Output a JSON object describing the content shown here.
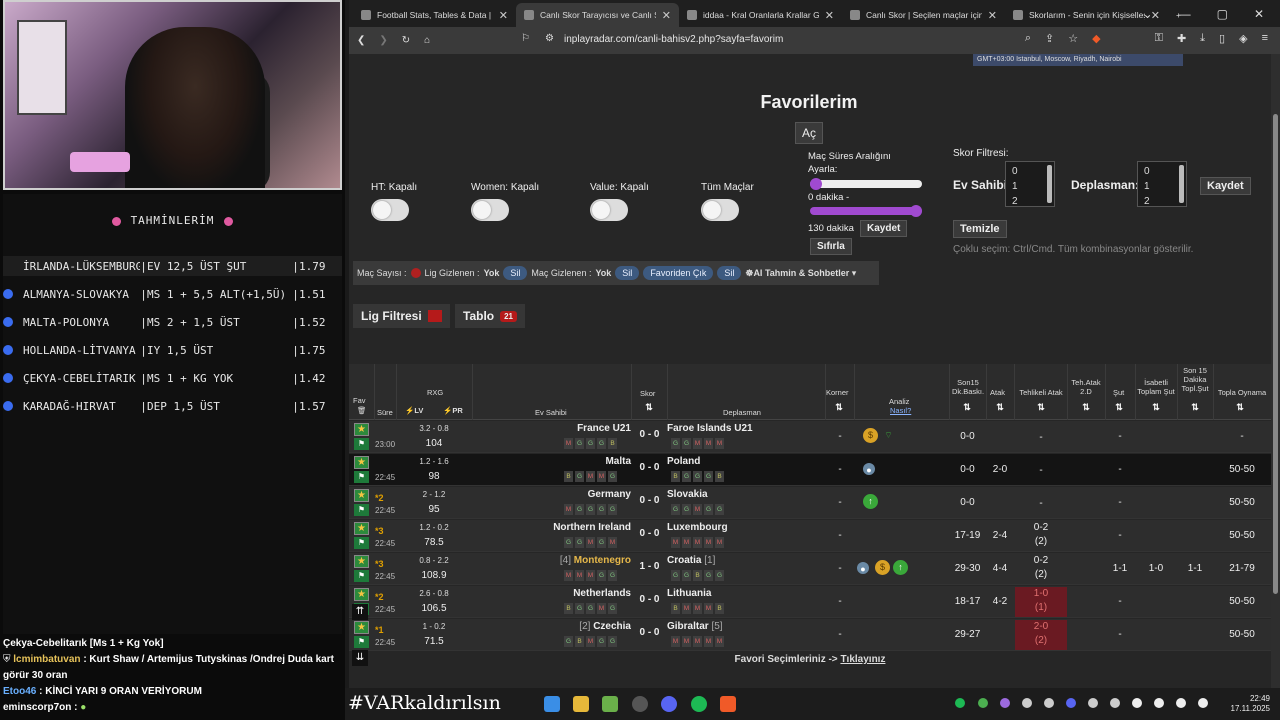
{
  "stream": {
    "predictions_title": "TAHMİNLERİM",
    "predictions": [
      {
        "match": "İRLANDA-LÜKSEMBURG",
        "tip": "EV 12,5 ÜST ŞUT",
        "odds": "1.79",
        "dot": false
      },
      {
        "match": "ALMANYA-SLOVAKYA",
        "tip": "MS 1 + 5,5 ALT(+1,5Ü)",
        "odds": "1.51",
        "dot": true
      },
      {
        "match": "MALTA-POLONYA",
        "tip": "MS 2 + 1,5 ÜST",
        "odds": "1.52",
        "dot": true
      },
      {
        "match": "HOLLANDA-LİTVANYA",
        "tip": "IY 1,5 ÜST",
        "odds": "1.75",
        "dot": true
      },
      {
        "match": "ÇEKYA-CEBELİTARIK",
        "tip": "MS 1 + KG YOK",
        "odds": "1.42",
        "dot": true
      },
      {
        "match": "KARADAĞ-HIRVAT",
        "tip": "DEP 1,5 ÜST",
        "odds": "1.57",
        "dot": true
      }
    ],
    "chat": [
      {
        "user": "",
        "text": "Çekya-Cebelitarık [Ms 1 + Kg Yok]"
      },
      {
        "user": "lcmimbatuvan",
        "text": ": Kurt Shaw / Artemijus Tutyskinas /Ondrej Duda kart görür 30 oran"
      },
      {
        "user": "Etoo46",
        "text": ": KİNCİ YARI 9 ORAN VERİYORUM"
      },
      {
        "user": "eminscorp7on",
        "text": ":"
      }
    ]
  },
  "browser": {
    "tabs": [
      {
        "label": "Football Stats, Tables & Data | Socc",
        "active": false
      },
      {
        "label": "Canlı Skor Tarayıcısı ve Canlı S",
        "active": true
      },
      {
        "label": "iddaa - Kral Oranlarla Krallar Gibi K",
        "active": false
      },
      {
        "label": "Canlı Skor | Seçilen maçlar için canl",
        "active": false
      },
      {
        "label": "Skorlarım - Senin için Kişiselleştirilm",
        "active": false
      }
    ],
    "url": "inplayradar.com/canli-bahisv2.php?sayfa=favorim",
    "timezone": "GMT+03:00 Istanbul, Moscow, Riyadh, Nairobi"
  },
  "page": {
    "title": "Favorilerim",
    "ac_button": "Aç",
    "toggles": [
      {
        "label": "HT: Kapalı"
      },
      {
        "label": "Women: Kapalı"
      },
      {
        "label": "Value: Kapalı"
      },
      {
        "label": "Tüm Maçlar"
      }
    ],
    "range": {
      "label1": "Maç Süres Aralığını",
      "label2": "Ayarla:",
      "min_label": "0 dakika -",
      "max_label": "130 dakika",
      "save": "Kaydet",
      "reset": "Sıfırla"
    },
    "score_filter": {
      "label": "Skor Filtresi:",
      "home": "Ev Sahibi:",
      "away": "Deplasman:",
      "home_options": [
        "0",
        "1",
        "2"
      ],
      "away_options": [
        "0",
        "1",
        "2"
      ],
      "save": "Kaydet",
      "clear": "Temizle",
      "note": "Çoklu seçim: Ctrl/Cmd. Tüm kombinasyonlar gösterilir."
    },
    "filterbar": {
      "count_label": "Maç Sayısı :",
      "lig_hidden": "Lig Gizlenen :",
      "lig_hidden_val": "Yok",
      "sil1": "Sil",
      "mac_hidden": "Maç Gizlenen :",
      "mac_hidden_val": "Yok",
      "sil2": "Sil",
      "fav_remove": "Favoriden Çık",
      "sil3": "Sil",
      "ai": "AI Tahmin & Sohbetler"
    },
    "lig_filter": "Lig Filtresi",
    "tablo": "Tablo",
    "tablo_count": "21",
    "headers": {
      "fav": "Fav",
      "sure": "Süre",
      "rxg": "RXG",
      "lv": "LV",
      "pr": "PR",
      "ev": "Ev Sahibi",
      "skor": "Skor",
      "dep": "Deplasman",
      "korner": "Korner",
      "analiz": "Analiz",
      "nasil": "Nasıl?",
      "son15": "Son15 Dk.Baskı.",
      "atak": "Atak",
      "teh": "Tehlikeli Atak",
      "teh2d": "Teh.Atak 2.D",
      "sut": "Şut",
      "isabetli": "İsabetli Toplam Şut",
      "son15s": "Son 15 Dakika Topl.Şut",
      "topla": "Topla Oynama"
    },
    "rows": [
      {
        "star": "",
        "time": "23:00",
        "rxg": "3.2 - 0.8",
        "rxg2": "104",
        "home": "France U21",
        "homeRank": "",
        "score": "0 - 0",
        "away": "Faroe Islands U21",
        "awayRank": "",
        "hf": [
          "M",
          "G",
          "G",
          "G",
          "B"
        ],
        "af": [
          "G",
          "G",
          "M",
          "M",
          "M"
        ],
        "korner": "-",
        "icons": [
          "bag",
          "wifi"
        ],
        "son15": "0-0",
        "atak": "",
        "teh": "-",
        "teh2": "",
        "sut": "-",
        "isa": "",
        "s15": "",
        "topla": "-",
        "dark": false
      },
      {
        "star": "",
        "time": "22:45",
        "rxg": "1.2 - 1.6",
        "rxg2": "98",
        "home": "Malta",
        "homeRank": "",
        "score": "0 - 0",
        "away": "Poland",
        "awayRank": "",
        "hf": [
          "B",
          "G",
          "M",
          "M",
          "G"
        ],
        "af": [
          "B",
          "G",
          "G",
          "G",
          "B"
        ],
        "korner": "-",
        "icons": [
          "bomb"
        ],
        "son15": "0-0",
        "atak": "2-0",
        "teh": "-",
        "teh2": "",
        "sut": "-",
        "isa": "",
        "s15": "",
        "topla": "50-50",
        "dark": true
      },
      {
        "star": "2",
        "time": "22:45",
        "rxg": "2 - 1.2",
        "rxg2": "95",
        "home": "Germany",
        "homeRank": "",
        "score": "0 - 0",
        "away": "Slovakia",
        "awayRank": "",
        "hf": [
          "M",
          "G",
          "G",
          "G",
          "G"
        ],
        "af": [
          "G",
          "G",
          "M",
          "G",
          "G"
        ],
        "korner": "-",
        "icons": [
          "up"
        ],
        "son15": "0-0",
        "atak": "",
        "teh": "-",
        "teh2": "",
        "sut": "-",
        "isa": "",
        "s15": "",
        "topla": "50-50",
        "dark": false
      },
      {
        "star": "3",
        "time": "22:45",
        "rxg": "1.2 - 0.2",
        "rxg2": "78.5",
        "home": "Northern Ireland",
        "homeRank": "",
        "score": "0 - 0",
        "away": "Luxembourg",
        "awayRank": "",
        "hf": [
          "G",
          "G",
          "M",
          "G",
          "M"
        ],
        "af": [
          "M",
          "M",
          "M",
          "M",
          "M"
        ],
        "korner": "-",
        "icons": [],
        "son15": "17-19",
        "atak": "2-4",
        "teh": "0-2",
        "teh2": "(2)",
        "sut": "-",
        "isa": "",
        "s15": "",
        "topla": "50-50",
        "dark": false
      },
      {
        "star": "3",
        "time": "22:45",
        "rxg": "0.8 - 2.2",
        "rxg2": "108.9",
        "home": "Montenegro",
        "homeRank": "[4]",
        "score": "1 - 0",
        "away": "Croatia",
        "awayRank": "[1]",
        "hf": [
          "M",
          "M",
          "M",
          "G",
          "G"
        ],
        "af": [
          "G",
          "G",
          "B",
          "G",
          "G"
        ],
        "korner": "-",
        "icons": [
          "bomb",
          "bag",
          "up"
        ],
        "son15": "29-30",
        "atak": "4-4",
        "teh": "0-2",
        "teh2": "(2)",
        "sut": "1-1",
        "isa": "1-0",
        "s15": "1-1",
        "topla": "21-79",
        "dark": false
      },
      {
        "star": "2",
        "time": "22:45",
        "rxg": "2.6 - 0.8",
        "rxg2": "106.5",
        "home": "Netherlands",
        "homeRank": "",
        "score": "0 - 0",
        "away": "Lithuania",
        "awayRank": "",
        "hf": [
          "B",
          "G",
          "G",
          "M",
          "G"
        ],
        "af": [
          "B",
          "M",
          "M",
          "M",
          "B"
        ],
        "korner": "-",
        "icons": [],
        "son15": "18-17",
        "atak": "4-2",
        "teh": "1-0",
        "teh2": "(1)",
        "sut": "-",
        "isa": "",
        "s15": "",
        "topla": "50-50",
        "dark": false,
        "red": true
      },
      {
        "star": "1",
        "time": "22:45",
        "rxg": "1 - 0.2",
        "rxg2": "71.5",
        "home": "Czechia",
        "homeRank": "[2]",
        "score": "0 - 0",
        "away": "Gibraltar",
        "awayRank": "[5]",
        "hf": [
          "G",
          "B",
          "M",
          "G",
          "G"
        ],
        "af": [
          "M",
          "M",
          "M",
          "M",
          "M"
        ],
        "korner": "-",
        "icons": [],
        "son15": "29-27",
        "atak": "",
        "teh": "2-0",
        "teh2": "(2)",
        "sut": "-",
        "isa": "",
        "s15": "",
        "topla": "50-50",
        "dark": false,
        "red": true
      }
    ],
    "footer": "Favori Seçimleriniz ->",
    "footer_link": "Tıklayınız"
  },
  "taskbar": {
    "hashtag": "#VARkaldırılsın",
    "time": "22:49",
    "date": "17.11.2025"
  }
}
